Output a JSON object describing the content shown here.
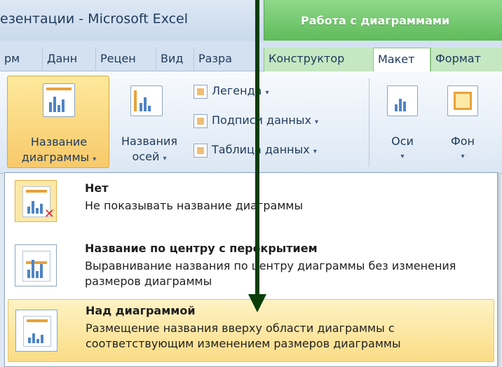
{
  "window": {
    "title": "езентации  -  Microsoft Excel",
    "context_title": "Работа с диаграммами"
  },
  "tabs": [
    {
      "label": "рм",
      "context": false,
      "active": false
    },
    {
      "label": "Данн",
      "context": false,
      "active": false
    },
    {
      "label": "Рецен",
      "context": false,
      "active": false
    },
    {
      "label": "Вид",
      "context": false,
      "active": false
    },
    {
      "label": "Разра",
      "context": false,
      "active": false
    },
    {
      "label": "Конструктор",
      "context": true,
      "active": false
    },
    {
      "label": "Макет",
      "context": true,
      "active": true
    },
    {
      "label": "Формат",
      "context": true,
      "active": false
    }
  ],
  "ribbon": {
    "chart_title_button": {
      "line1": "Название",
      "line2": "диаграммы",
      "pressed": true
    },
    "axis_titles_button": {
      "line1": "Названия",
      "line2": "осей"
    },
    "legend_button": "Легенда",
    "data_labels_button": "Подписи данных",
    "data_table_button": "Таблица данных",
    "axes_button": "Оси",
    "background_button": "Фон",
    "dropdown_caret": "▾"
  },
  "menu": {
    "items": [
      {
        "title": "Нет",
        "description": "Не показывать название диаграммы",
        "selected": true,
        "highlighted": false
      },
      {
        "title": "Название по центру с перекрытием",
        "description": "Выравнивание названия по центру диаграммы без изменения размеров диаграммы",
        "selected": false,
        "highlighted": false
      },
      {
        "title": "Над диаграммой",
        "description": "Размещение названия вверху области диаграммы с соответствующим изменением размеров диаграммы",
        "selected": false,
        "highlighted": true
      }
    ]
  },
  "colors": {
    "arrow": "#0b3d0b",
    "context_green": "#5fbb5a",
    "highlight": "#fbdc86",
    "accent_blue": "#4f84c4"
  }
}
